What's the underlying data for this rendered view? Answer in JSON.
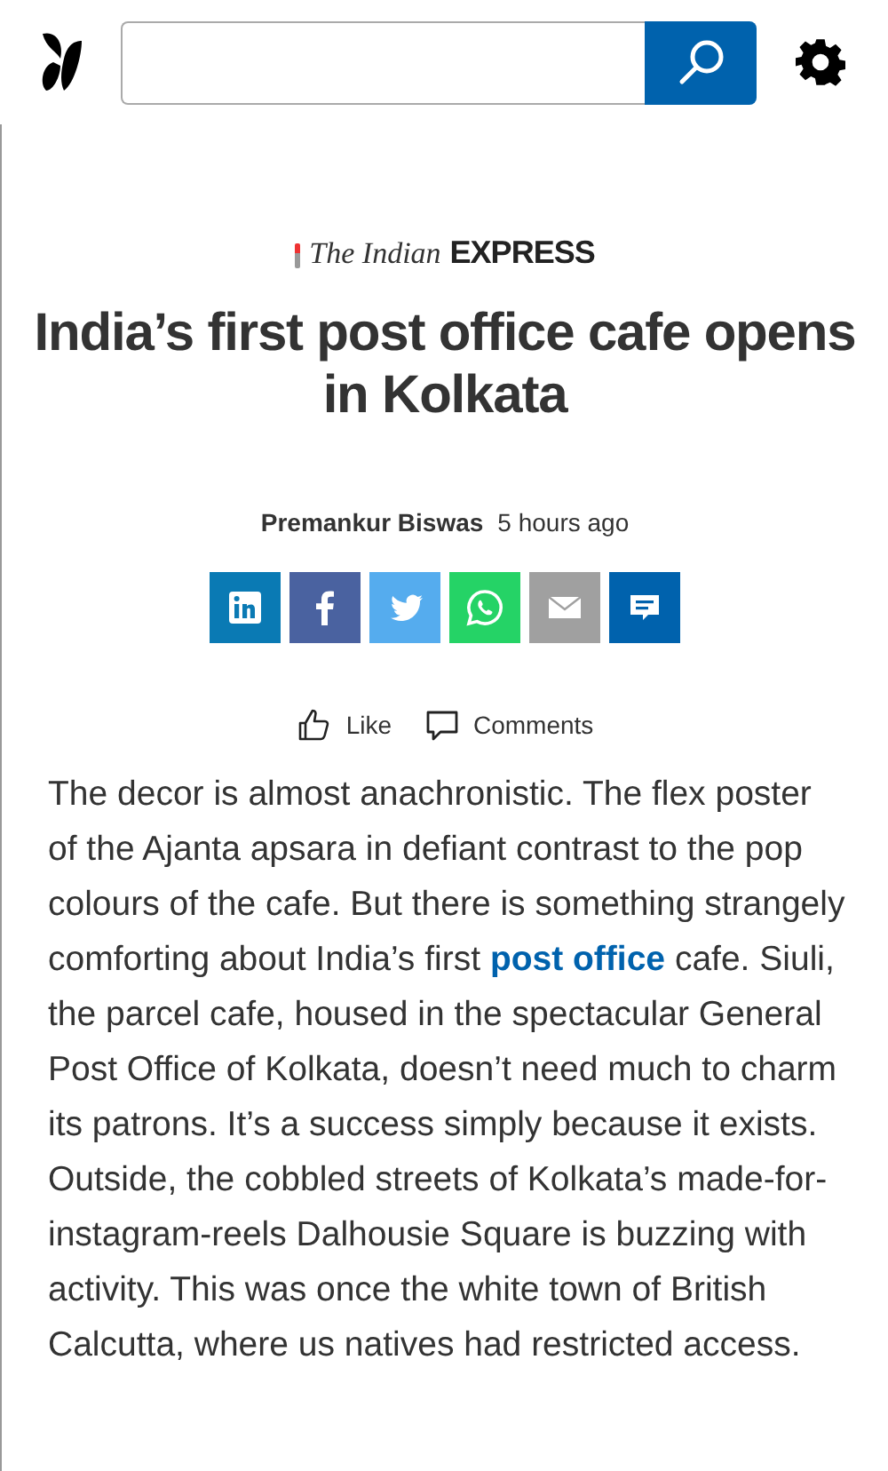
{
  "article": {
    "source": {
      "part_1": "The Indian",
      "part_2": "EXPRESS"
    },
    "title": "India’s first post office cafe opens in Kolkata",
    "author": "Premankur Biswas",
    "time": "5 hours ago",
    "share_buttons": [
      {
        "kind": "linkedin",
        "color": "#0a7ab4"
      },
      {
        "kind": "facebook",
        "color": "#4a62a0"
      },
      {
        "kind": "twitter",
        "color": "#55acee"
      },
      {
        "kind": "whatsapp",
        "color": "#25d366"
      },
      {
        "kind": "email",
        "color": "#a0a0a0"
      },
      {
        "kind": "comment",
        "color": "#0062ad"
      }
    ],
    "actions": [
      {
        "kind": "like",
        "label": "Like"
      },
      {
        "kind": "comments",
        "label": "Comments"
      }
    ],
    "body": [
      {
        "kind": "text",
        "text": "The decor is almost anachronistic. The flex poster of the Ajanta apsara in defiant contrast to the pop colours of the cafe. But there is something strangely comforting about India’s first "
      },
      {
        "kind": "link",
        "text": "post office"
      },
      {
        "kind": "text",
        "text": " cafe. Siuli, the parcel cafe, housed in the spectacular General Post Office of Kolkata, doesn’t need much to charm its patrons. It’s a success simply because it exists. Outside, the cobbled streets of Kolkata’s made-for-instagram-reels Dalhousie Square is buzzing with activity. This was once the white town of British Calcutta, where us natives had restricted access."
      }
    ]
  }
}
